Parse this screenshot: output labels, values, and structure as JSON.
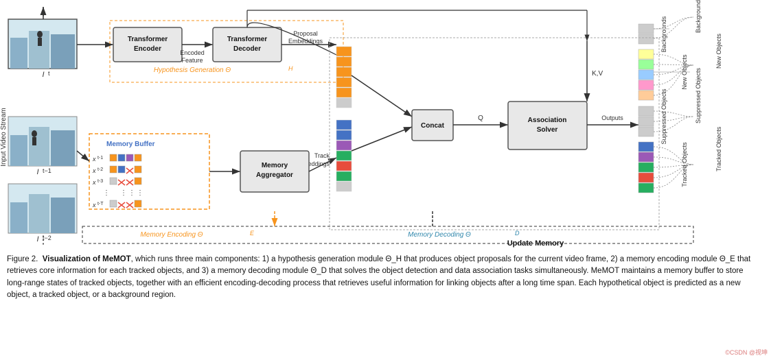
{
  "diagram": {
    "title": "Figure 2 Visualization of MeMOT",
    "labels": {
      "transformer_encoder": "Transformer Encoder",
      "transformer_decoder": "Transformer Decoder",
      "memory_aggregator": "Memory Aggregator",
      "association_solver": "Association Solver",
      "concat": "Concat",
      "encoded_feature": "Encoded Feature",
      "proposal_embeddings": "Proposal Embeddings",
      "track_embeddings": "Track Embeddings",
      "hypothesis_generation": "Hypothesis Generation Θ",
      "hypothesis_theta": "H",
      "memory_encoding": "Memory Encoding Θ",
      "memory_encoding_theta": "E",
      "memory_decoding": "Memory Decoding Θ",
      "memory_decoding_theta": "D",
      "update_memory": "Update Memory",
      "input_video_stream": "Input Video Stream",
      "memory_buffer": "Memory Buffer",
      "outputs": "Outputs",
      "kv": "K,V",
      "q": "Q",
      "backgrounds": "Backgrounds",
      "new_objects": "New Objects",
      "suppressed_objects": "Suppressed Objects",
      "tracked_objects": "Tracked Objects",
      "it": "I t",
      "it_minus_1": "I t−1",
      "it_minus_2": "I t−2"
    }
  },
  "caption": {
    "figure_label": "Figure 2.",
    "bold_text": "Visualization of MeMOT",
    "text": ", which runs three main components: 1) a hypothesis generation module Θ_H that produces object proposals for the current video frame, 2) a memory encoding module Θ_E that retrieves core information for each tracked objects, and 3) a memory decoding module Θ_D that solves the object detection and data association tasks simultaneously. MeMOT maintains a memory buffer to store long-range states of tracked objects, together with an efficient encoding-decoding process that retrieves useful information for linking objects after a long time span. Each hypothetical object is predicted as a new object, a tracked object, or a background region."
  },
  "watermark": "©CSDN @视坤"
}
